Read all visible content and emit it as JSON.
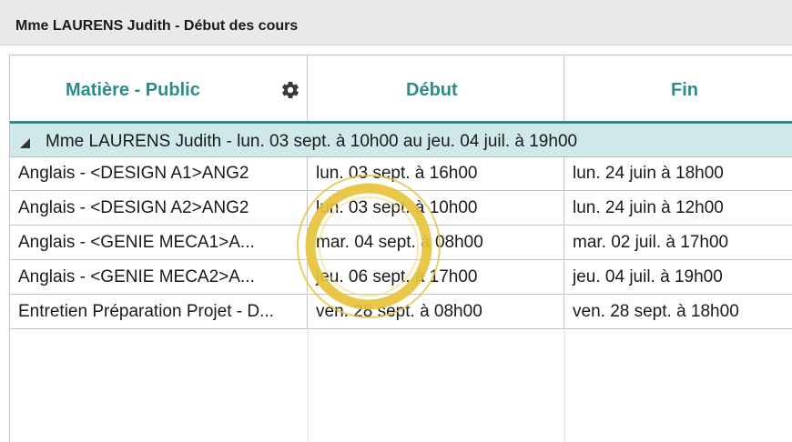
{
  "window": {
    "title": "Mme LAURENS Judith - Début des cours"
  },
  "table": {
    "columns": [
      "Matière - Public",
      "Début",
      "Fin"
    ],
    "settings_icon": "gear-icon",
    "group": {
      "label": "Mme LAURENS Judith - lun. 03 sept. à 10h00 au jeu. 04 juil. à 19h00",
      "expand_icon": "triangle-down-icon"
    },
    "rows": [
      [
        "Anglais - <DESIGN A1>ANG2",
        "lun. 03 sept. à 16h00",
        "lun. 24 juin à 18h00"
      ],
      [
        "Anglais - <DESIGN A2>ANG2",
        "lun. 03 sept. à 10h00",
        "lun. 24 juin à 12h00"
      ],
      [
        "Anglais - <GENIE MECA1>A...",
        "mar. 04 sept. à 08h00",
        "mar. 02 juil. à 17h00"
      ],
      [
        "Anglais - <GENIE MECA2>A...",
        "jeu. 06 sept. à 17h00",
        "jeu. 04 juil. à 19h00"
      ],
      [
        "Entretien Préparation Projet - D...",
        "ven. 28 sept. à 08h00",
        "ven. 28 sept. à 18h00"
      ]
    ]
  },
  "colors": {
    "accent": "#2b8c8c",
    "group_background": "#cfe9ea",
    "highlight_ring": "#e6c23a"
  }
}
